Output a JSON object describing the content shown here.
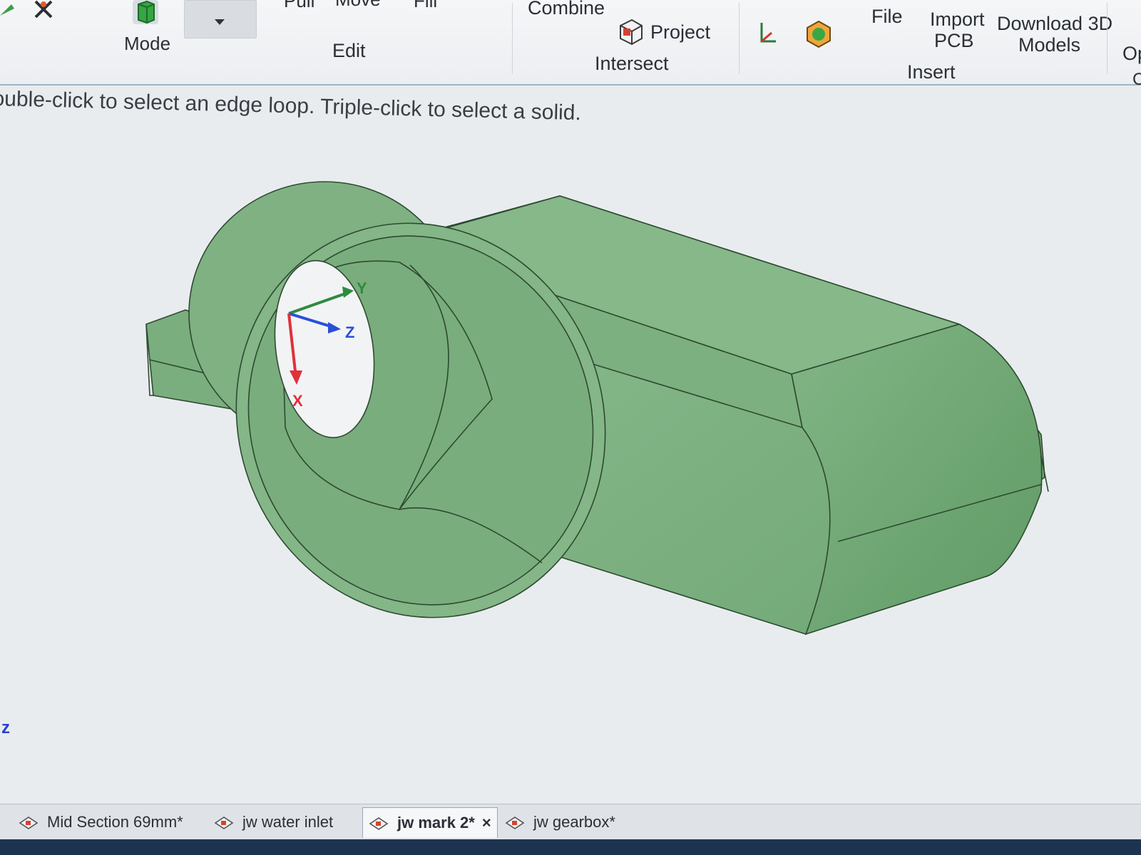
{
  "ribbon": {
    "top_labels_clipped": [
      "Pull",
      "Move",
      "Fill"
    ],
    "mode_label": "Mode",
    "edit_label": "Edit",
    "combine_label": "Combine",
    "project_label": "Project",
    "intersect_label": "Intersect",
    "file_label": "File",
    "import_pcb_line1": "Import",
    "import_pcb_line2": "PCB",
    "download_line1": "Download 3D",
    "download_line2": "Models",
    "insert_label": "Insert",
    "clipped_right_1": "Op",
    "clipped_right_2": "C"
  },
  "status": {
    "hint": "ouble-click to select an edge loop. Triple-click to select a solid."
  },
  "viewport": {
    "axis_x": "X",
    "axis_y": "Y",
    "axis_z": "Z",
    "view_indicator": "z",
    "model_color": "#7fb184",
    "background": "#e9ecef"
  },
  "tabs": [
    {
      "label": "Mid Section 69mm*"
    },
    {
      "label": "jw water inlet"
    },
    {
      "label": "jw mark 2*",
      "active": true,
      "close": "×"
    },
    {
      "label": "jw gearbox*"
    }
  ],
  "colors": {
    "axis_x": "#e0303a",
    "axis_y": "#2e8b3e",
    "axis_z": "#2a4fd8"
  },
  "icons": [
    "mode-icon",
    "dropdown-arrow-icon",
    "project-icon",
    "axis-tool-icon",
    "component-icon",
    "document-icon"
  ]
}
